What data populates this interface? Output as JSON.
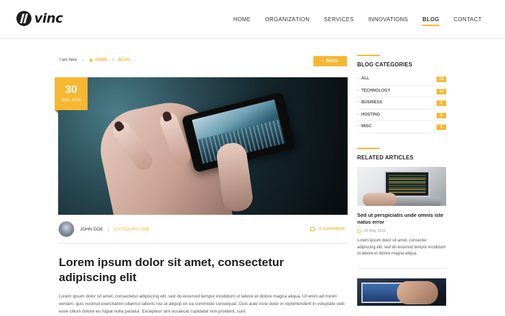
{
  "brand": {
    "name": "vinc"
  },
  "nav": {
    "items": [
      {
        "label": "HOME",
        "active": false
      },
      {
        "label": "ORGANIZATION",
        "active": false
      },
      {
        "label": "SERVICES",
        "active": false
      },
      {
        "label": "INNOVATIONS",
        "active": false
      },
      {
        "label": "BLOG",
        "active": true
      },
      {
        "label": "CONTACT",
        "active": false
      }
    ]
  },
  "breadcrumb": {
    "prefix": "I am here",
    "separator": "→",
    "items": [
      "HOME",
      "BLOG"
    ],
    "back_label": "BACK"
  },
  "post": {
    "date_day": "30",
    "date_month": "MAY, 2015",
    "author": "JOHN DOE",
    "category": "CATEGORY ONE",
    "comments": "1 comments",
    "title": "Lorem ipsum dolor sit amet, consectetur adipiscing elit",
    "body": "Lorem ipsum dolor sit amet, consectetur adipiscing elit, sed do eiusmod tempor incididunt ut labore et dolore magna aliqua. Ut enim ad minim veniam, quis nostrud exercitation ullamco laboris nisi ut aliquip ex ea commodo consequat. Duis aute irure dolor in reprehenderit in voluptate velit esse cillum dolore eu fugiat nulla pariatur. Excepteur sint occaecat cupidatat non proident, sunt"
  },
  "sidebar": {
    "categories_title": "BLOG CATEGORIES",
    "categories": [
      {
        "label": "ALL",
        "count": "24"
      },
      {
        "label": "TECHNOLOGY",
        "count": "12"
      },
      {
        "label": "BUSINESS",
        "count": "4"
      },
      {
        "label": "HOSTING",
        "count": "6"
      },
      {
        "label": "MISC",
        "count": "2"
      }
    ],
    "related_title": "RELATED ARTICLES",
    "article": {
      "title": "Sed ut perspiciatis unde omnis iste natus error",
      "date": "25 May 2015",
      "excerpt": "Lorem ipsum dolor sit amet, consecter adipiscing elit, sed do eiusmod tempor incididunt ut labore et dolore magna aliqua."
    }
  },
  "colors": {
    "accent": "#f7b731",
    "text": "#222222"
  },
  "icons": {
    "home": "home-icon",
    "back": "chevron-left-icon",
    "comment": "comment-icon",
    "clock": "clock-icon"
  }
}
